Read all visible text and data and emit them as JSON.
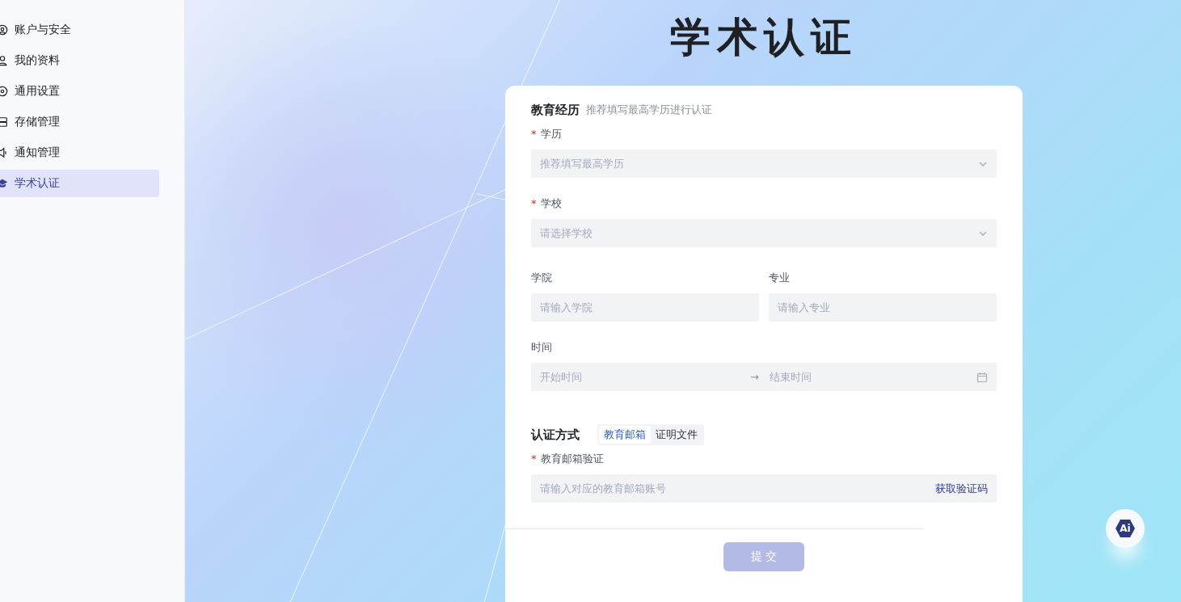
{
  "sidebar": {
    "items": [
      {
        "label": "账户与安全",
        "selected": false
      },
      {
        "label": "我的资料",
        "selected": false
      },
      {
        "label": "通用设置",
        "selected": false
      },
      {
        "label": "存储管理",
        "selected": false
      },
      {
        "label": "通知管理",
        "selected": false
      },
      {
        "label": "学术认证",
        "selected": true
      }
    ]
  },
  "page_title": "学术认证",
  "education": {
    "title": "教育经历",
    "hint": "推荐填写最高学历进行认证",
    "fields": [
      {
        "kind": "select",
        "label": "学历",
        "required_mark": "*",
        "placeholder": "推荐填写最高学历"
      },
      {
        "kind": "select",
        "label": "学校",
        "required_mark": "*",
        "placeholder": "请选择学校"
      },
      {
        "kind": "pair",
        "items": [
          {
            "label": "学院",
            "placeholder": "请输入学院"
          },
          {
            "label": "专业",
            "placeholder": "请输入专业"
          }
        ]
      },
      {
        "kind": "daterange",
        "label": "时间",
        "start_placeholder": "开始时间",
        "separator": "→",
        "end_placeholder": "结束时间"
      }
    ]
  },
  "verification": {
    "title": "认证方式",
    "tabs": [
      {
        "label": "教育邮箱",
        "selected": true
      },
      {
        "label": "证明文件",
        "selected": false
      }
    ],
    "field": {
      "label": "教育邮箱验证",
      "required_mark": "*",
      "placeholder": "请输入对应的教育邮箱账号",
      "action": "获取验证码"
    }
  },
  "submit": {
    "label": "提 交",
    "disabled": true
  },
  "ai_button": {
    "label": "Ai"
  }
}
